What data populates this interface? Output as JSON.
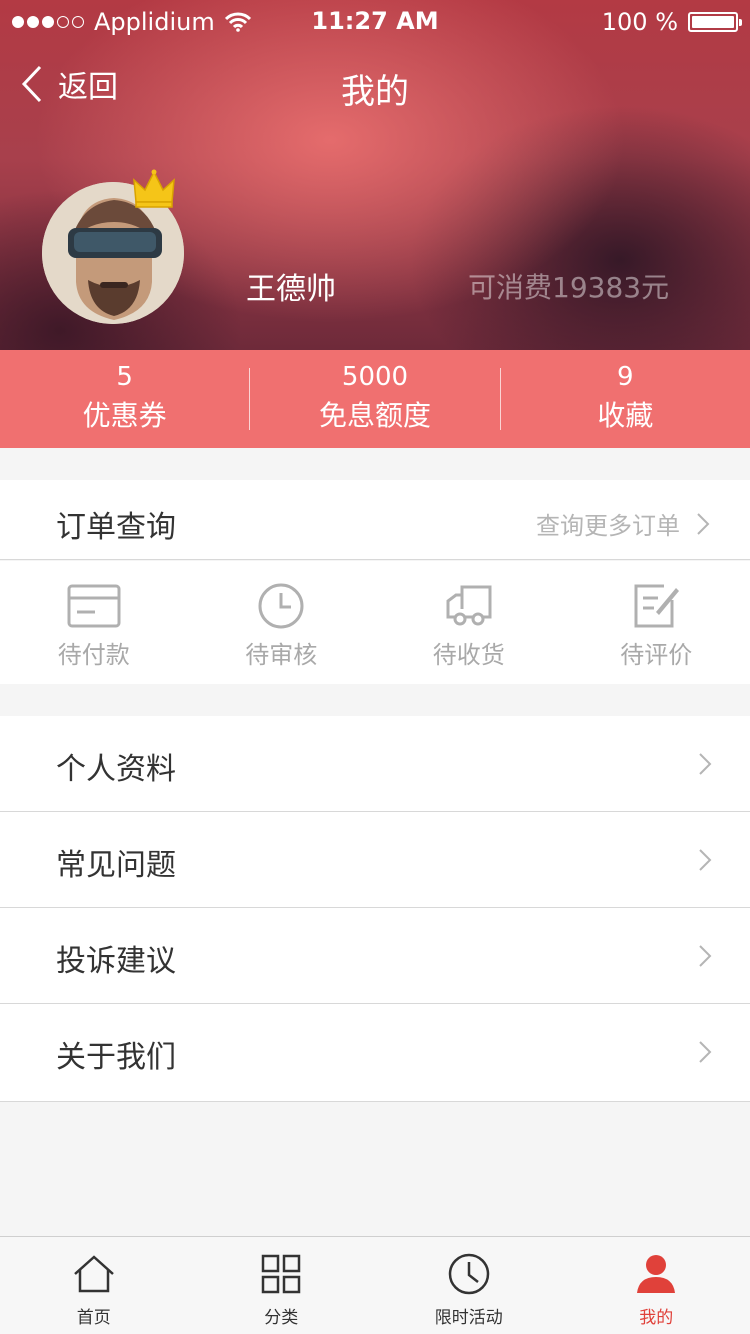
{
  "status_bar": {
    "carrier": "Applidium",
    "time": "11:27 AM",
    "battery": "100 %"
  },
  "nav": {
    "back_label": "返回",
    "title": "我的"
  },
  "profile": {
    "username": "王德帅",
    "balance": "可消费19383元"
  },
  "stats": [
    {
      "value": "5",
      "label": "优惠券"
    },
    {
      "value": "5000",
      "label": "免息额度"
    },
    {
      "value": "9",
      "label": "收藏"
    }
  ],
  "orders": {
    "title": "订单查询",
    "more_label": "查询更多订单",
    "items": [
      {
        "label": "待付款",
        "icon": "card-icon"
      },
      {
        "label": "待审核",
        "icon": "clock-icon"
      },
      {
        "label": "待收货",
        "icon": "truck-icon"
      },
      {
        "label": "待评价",
        "icon": "edit-icon"
      }
    ]
  },
  "menu": [
    {
      "label": "个人资料"
    },
    {
      "label": "常见问题"
    },
    {
      "label": "投诉建议"
    },
    {
      "label": "关于我们"
    }
  ],
  "tabbar": [
    {
      "label": "首页",
      "icon": "home-icon"
    },
    {
      "label": "分类",
      "icon": "grid-icon"
    },
    {
      "label": "限时活动",
      "icon": "clock-icon"
    },
    {
      "label": "我的",
      "icon": "person-icon",
      "active": true
    }
  ],
  "colors": {
    "accent": "#f07070",
    "active_tab": "#e0413a",
    "crown": "#f5c518"
  }
}
